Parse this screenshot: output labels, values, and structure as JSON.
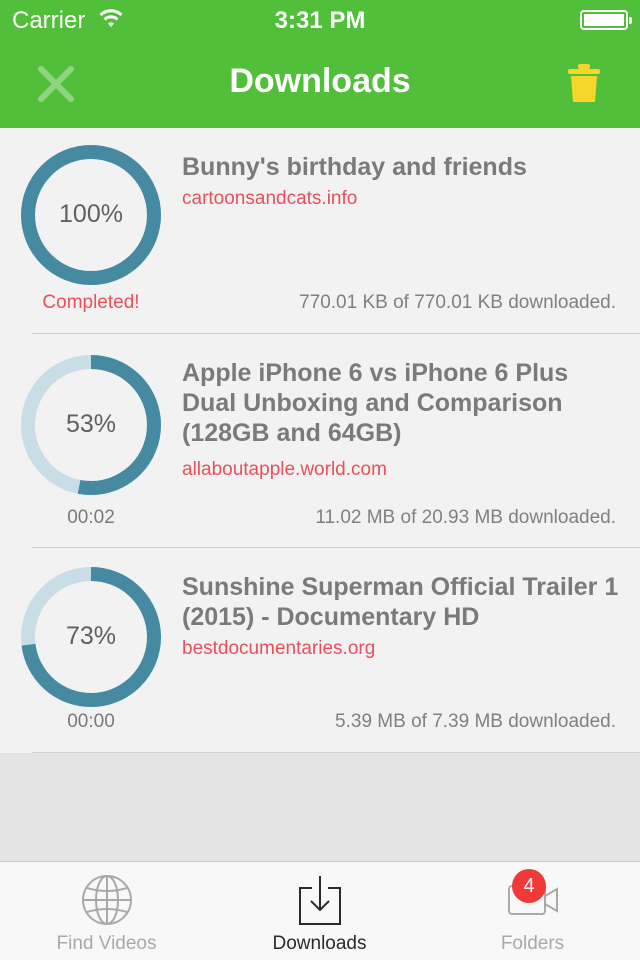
{
  "status_bar": {
    "carrier": "Carrier",
    "time": "3:31 PM"
  },
  "header": {
    "title": "Downloads",
    "close_icon": "close-icon",
    "trash_icon": "trash-icon",
    "color": "#52bf3b"
  },
  "downloads": [
    {
      "title": "Bunny's birthday and friends",
      "host": "cartoonsandcats.info",
      "progress_label": "100%",
      "progress": 1.0,
      "status": "Completed!",
      "size": "770.01 KB of 770.01 KB downloaded."
    },
    {
      "title": "Apple iPhone 6 vs iPhone 6 Plus Dual Unboxing and Comparison (128GB and 64GB)",
      "host": "allaboutapple.world.com",
      "progress_label": "53%",
      "progress": 0.53,
      "status": "00:02",
      "size": "11.02 MB of 20.93 MB downloaded."
    },
    {
      "title": "Sunshine Superman Official Trailer 1 (2015) - Documentary HD",
      "host": "bestdocumentaries.org",
      "progress_label": "73%",
      "progress": 0.73,
      "status": "00:00",
      "size": "5.39 MB of 7.39 MB downloaded."
    }
  ],
  "tabbar": {
    "tabs": [
      {
        "label": "Find Videos",
        "icon": "globe-icon"
      },
      {
        "label": "Downloads",
        "icon": "download-icon"
      },
      {
        "label": "Folders",
        "icon": "video-folder-icon",
        "badge": "4"
      }
    ]
  }
}
